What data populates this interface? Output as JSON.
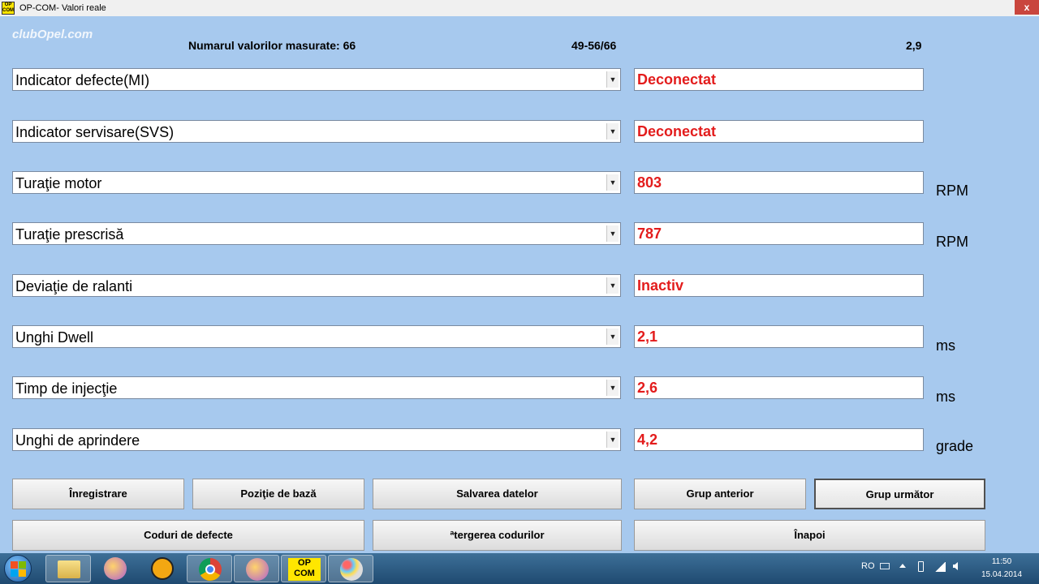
{
  "window": {
    "title": "OP-COM- Valori reale",
    "icon_text_top": "OP",
    "icon_text_bottom": "COM",
    "close_label": "x"
  },
  "watermark": "clubOpel.com",
  "header": {
    "count_label": "Numarul valorilor masurate: 66",
    "range": "49-56/66",
    "version": "2,9"
  },
  "rows": [
    {
      "label": "Indicator defecte(MI)",
      "value": "Deconectat",
      "unit": ""
    },
    {
      "label": "Indicator servisare(SVS)",
      "value": "Deconectat",
      "unit": ""
    },
    {
      "label": "Turaţie motor",
      "value": "803",
      "unit": "RPM"
    },
    {
      "label": "Turaţie prescrisă",
      "value": "787",
      "unit": "RPM"
    },
    {
      "label": "Deviaţie de ralanti",
      "value": "Inactiv",
      "unit": ""
    },
    {
      "label": "Unghi Dwell",
      "value": "2,1",
      "unit": "ms"
    },
    {
      "label": "Timp de injecţie",
      "value": "2,6",
      "unit": "ms"
    },
    {
      "label": "Unghi de aprindere",
      "value": "4,2",
      "unit": "grade"
    }
  ],
  "buttons": {
    "record": "Înregistrare",
    "base_position": "Poziţie de bază",
    "save_data": "Salvarea datelor",
    "prev_group": "Grup anterior",
    "next_group": "Grup următor",
    "fault_codes": "Coduri de defecte",
    "clear_codes": "ªtergerea codurilor",
    "back": "Înapoi"
  },
  "dropdown_glyph": "▼",
  "taskbar": {
    "opcom_top": "OP",
    "opcom_bottom": "COM",
    "language": "RO",
    "time": "11:50",
    "date": "15.04.2014"
  }
}
